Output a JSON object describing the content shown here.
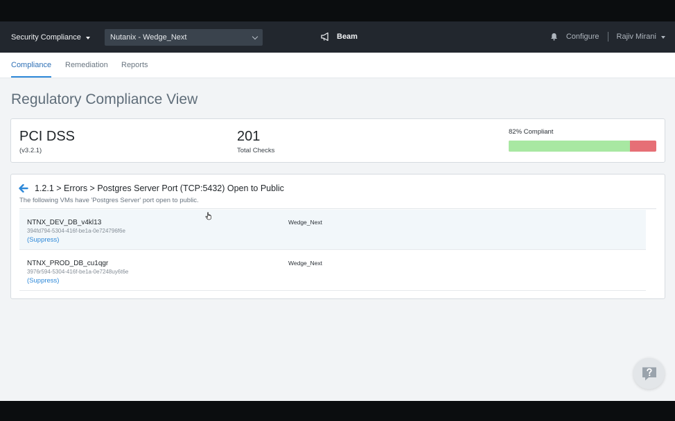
{
  "header": {
    "app_menu": "Security Compliance",
    "environment": "Nutanix - Wedge_Next",
    "brand": "Beam",
    "configure": "Configure",
    "user": "Rajiv Mirani"
  },
  "tabs": [
    {
      "label": "Compliance",
      "active": true
    },
    {
      "label": "Remediation",
      "active": false
    },
    {
      "label": "Reports",
      "active": false
    }
  ],
  "page": {
    "title": "Regulatory Compliance View"
  },
  "summary": {
    "framework": "PCI DSS",
    "version": "(v3.2.1)",
    "total_checks": "201",
    "total_checks_label": "Total Checks",
    "compliant_label": "82% Compliant",
    "compliant_fraction": 0.82
  },
  "detail": {
    "title": "1.2.1 > Errors > Postgres Server Port (TCP:5432) Open to Public",
    "subtitle": "The following VMs have 'Postgres Server' port open to public.",
    "vms": [
      {
        "name": "NTNX_DEV_DB_v4kl13",
        "id": "394fd794-5304-416f-be1a-0e724796f6e",
        "action": "(Suppress)",
        "cluster": "Wedge_Next"
      },
      {
        "name": "NTNX_PROD_DB_cu1qgr",
        "id": "3976r594-5304-416f-be1a-0e7248uy6t6e",
        "action": "(Suppress)",
        "cluster": "Wedge_Next"
      }
    ]
  },
  "colors": {
    "topbar": "#22272e",
    "accent": "#2d88d8",
    "compliant": "#a8e8a2",
    "non_compliant": "#e66f76"
  },
  "icons": [
    "chevron-down-icon",
    "megaphone-icon",
    "bell-icon",
    "back-arrow-icon",
    "pointer-cursor-icon",
    "help-chat-icon"
  ]
}
